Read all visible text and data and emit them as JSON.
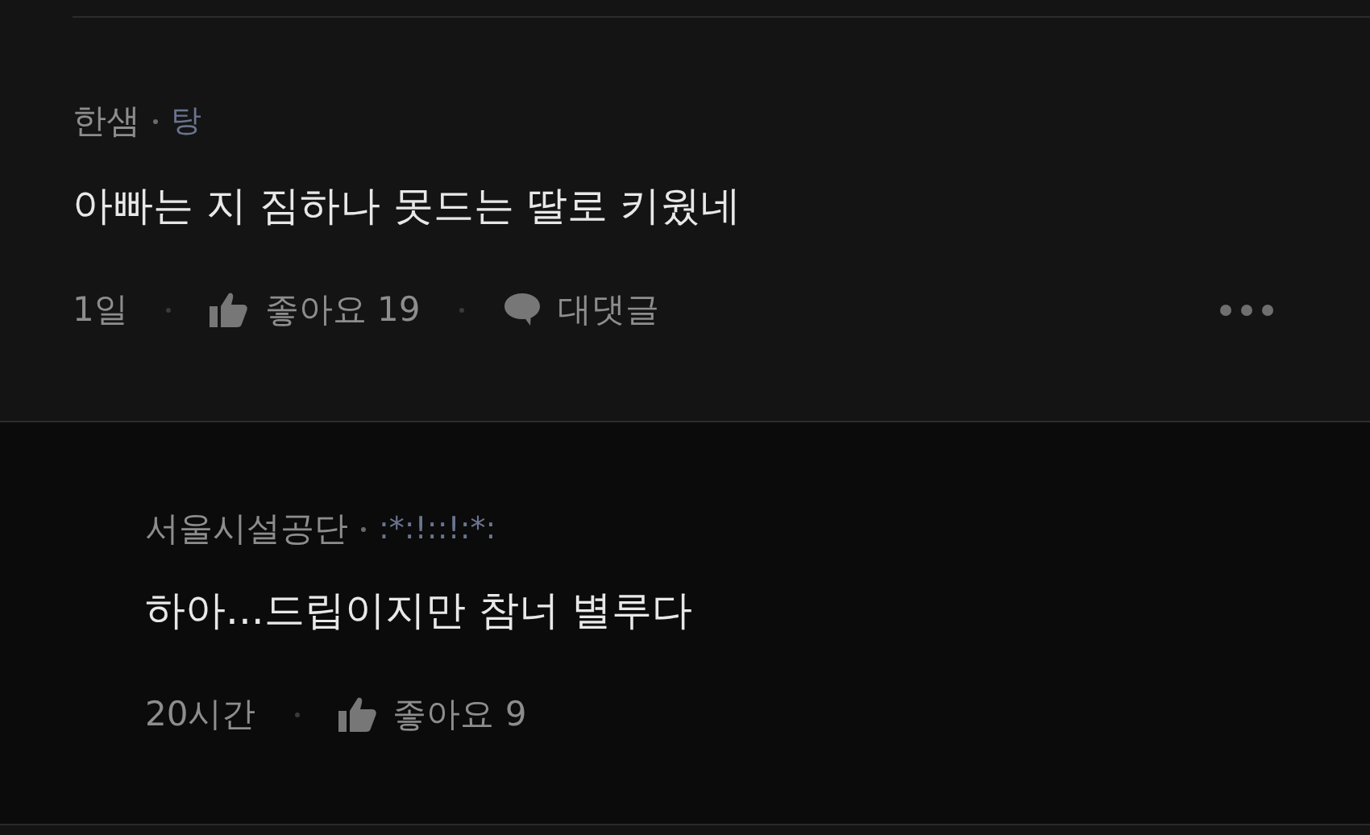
{
  "comments": [
    {
      "kind": "comment",
      "author": "한샘",
      "badge": "탕",
      "text": "아빠는 지 짐하나 못드는 딸로 키웠네",
      "time": "1일",
      "likes": "좋아요 19",
      "reply_label": "대댓글",
      "more_menu": true
    },
    {
      "kind": "reply",
      "author": "서울시설공단",
      "badge": ":*:!::!:*:",
      "text": "하아...드립이지만 참너 별루다",
      "time": "20시간",
      "likes": "좋아요 9",
      "more_menu": false
    }
  ]
}
